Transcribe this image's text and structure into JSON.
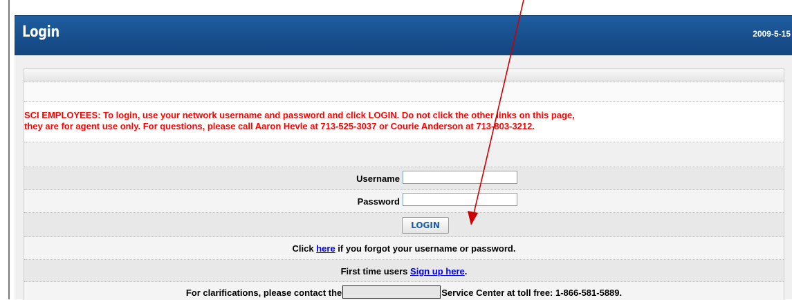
{
  "header": {
    "title": "Login",
    "date": "2009-5-15"
  },
  "notice": {
    "line1": "SCI EMPLOYEES: To login, use your network username and password and click LOGIN. Do not click the other links on this page,",
    "line2": "they are for agent use only. For questions, please call Aaron Hevle at 713-525-3037 or Courie Anderson at 713-803-3212."
  },
  "form": {
    "username_label": "Username",
    "username_value": "",
    "password_label": "Password",
    "password_value": "",
    "login_label": "LOGIN"
  },
  "forgot": {
    "prefix": "Click ",
    "link": "here",
    "suffix": " if you forgot your username or password."
  },
  "first_time": {
    "prefix": "First time users ",
    "link": "Sign up here",
    "suffix": "."
  },
  "contact": {
    "prefix": "For clarifications, please contact the",
    "suffix": "Service Center at toll free: 1-866-581-5889."
  },
  "colors": {
    "header_blue": "#174f8c",
    "notice_red": "#ff0000",
    "link_blue": "#0000ee",
    "arrow_red": "#cc0000"
  }
}
